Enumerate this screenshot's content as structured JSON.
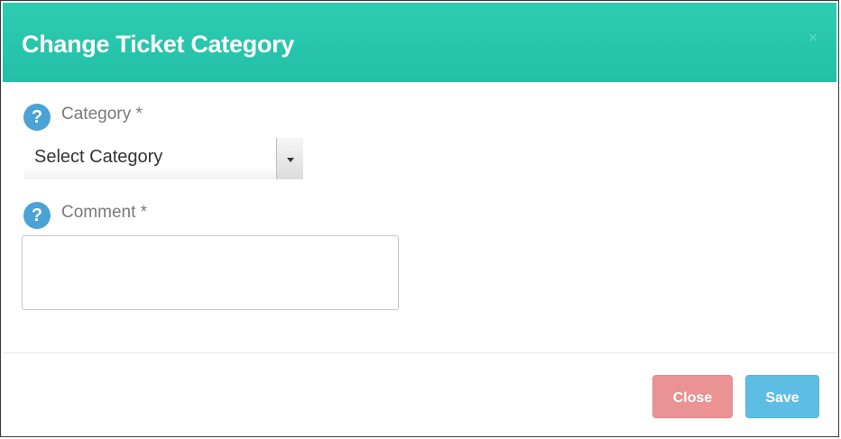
{
  "dialog": {
    "title": "Change Ticket Category",
    "header_close_glyph": "⨯",
    "header_color": "#28c7ad"
  },
  "fields": {
    "category": {
      "label": "Category *",
      "help_glyph": "?",
      "selected_value": "Select Category"
    },
    "comment": {
      "label": "Comment *",
      "help_glyph": "?",
      "value": ""
    }
  },
  "footer": {
    "close_label": "Close",
    "save_label": "Save",
    "close_color": "#ea9294",
    "save_color": "#5ebde3"
  },
  "icons": {
    "help": "question-circle-icon",
    "caret": "caret-down-icon",
    "dismiss": "close-icon"
  }
}
